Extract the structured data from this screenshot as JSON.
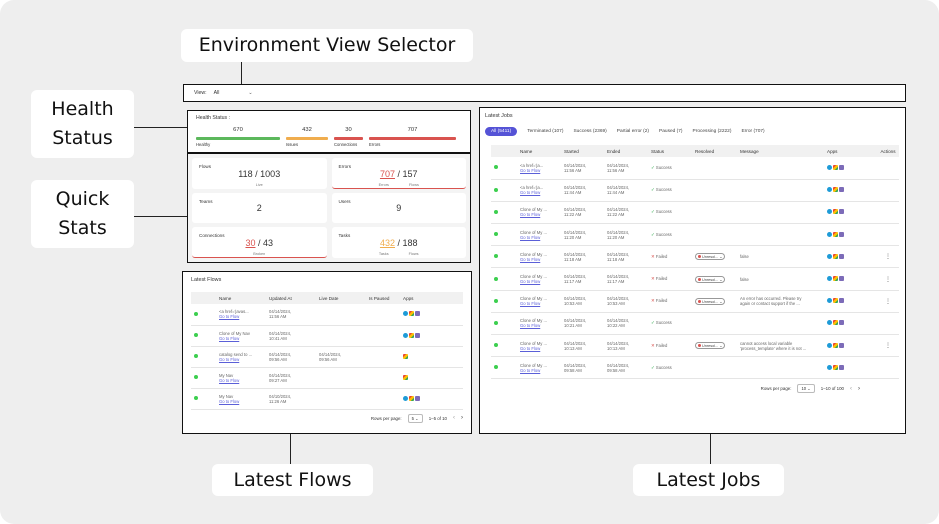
{
  "labels": {
    "env_selector": "Environment View Selector",
    "health_status": [
      "Health",
      "Status"
    ],
    "quick_stats": [
      "Quick",
      "Stats"
    ],
    "latest_flows": "Latest Flows",
    "latest_jobs": "Latest Jobs"
  },
  "view_selector": {
    "label": "View:",
    "value": "All"
  },
  "health": {
    "title": "Health Status :",
    "items": [
      {
        "value": "670",
        "label": "Healthy",
        "color": "#5cb85c"
      },
      {
        "value": "432",
        "label": "Issues",
        "color": "#f0ad4e"
      },
      {
        "value": "30",
        "label": "Connections",
        "color": "#d9534f"
      },
      {
        "value": "707",
        "label": "Errors",
        "color": "#d9534f"
      }
    ]
  },
  "quick_stats": {
    "flows": {
      "label": "Flows",
      "value": "118",
      "total": "1003",
      "sub": "Live"
    },
    "errors": {
      "label": "Errors",
      "value": "707",
      "total": "157",
      "sub1": "Errors",
      "sub2": "Flows"
    },
    "teams": {
      "label": "Teams",
      "value": "2"
    },
    "users": {
      "label": "Users",
      "value": "9"
    },
    "connections": {
      "label": "Connections",
      "value": "30",
      "total": "43",
      "sub": "Broken"
    },
    "tasks": {
      "label": "Tasks",
      "value": "432",
      "total": "188",
      "sub1": "Tasks",
      "sub2": "Flows"
    }
  },
  "flows": {
    "title": "Latest Flows",
    "columns": [
      "",
      "Name",
      "Updated At",
      "Live Date",
      "Is Paused",
      "Apps"
    ],
    "rows": [
      {
        "name": "<a href='javas...",
        "link": "Go to Flow",
        "updated": [
          "04/14/2024,",
          "11:56 AM"
        ],
        "live": [
          "",
          ""
        ]
      },
      {
        "name": "Clone of My Nav",
        "link": "Go to Flow",
        "updated": [
          "04/14/2024,",
          "10:41 AM"
        ],
        "live": [
          "",
          ""
        ]
      },
      {
        "name": "catalog send to ...",
        "link": "Go to Flow",
        "updated": [
          "04/14/2024,",
          "09:56 AM"
        ],
        "live": [
          "04/14/2024,",
          "09:56 AM"
        ]
      },
      {
        "name": "My Nav",
        "link": "Go to Flow",
        "updated": [
          "04/14/2024,",
          "09:27 AM"
        ],
        "live": [
          "",
          ""
        ]
      },
      {
        "name": "My Nav",
        "link": "Go to Flow",
        "updated": [
          "04/10/2024,",
          "11:26 AM"
        ],
        "live": [
          "",
          ""
        ]
      }
    ],
    "rows_per_page_label": "Rows per page:",
    "rows_per_page": "5",
    "range": "1–5 of 10"
  },
  "jobs": {
    "title": "Latest Jobs",
    "tabs": [
      "All (5411)",
      "Terminated (107)",
      "Success (2369)",
      "Partial error (2)",
      "Paused (7)",
      "Processing (2222)",
      "Error (707)"
    ],
    "columns": [
      "",
      "Name",
      "Started",
      "Ended",
      "Status",
      "Resolved",
      "Message",
      "Apps",
      "Actions"
    ],
    "rows": [
      {
        "name": "<a href='ja...",
        "link": "Go to Flow",
        "started": [
          "04/14/2024,",
          "11:56 AM"
        ],
        "ended": [
          "04/14/2024,",
          "11:56 AM"
        ],
        "status": "Success",
        "resolved": "",
        "message": []
      },
      {
        "name": "<a href='ja...",
        "link": "Go to Flow",
        "started": [
          "04/14/2024,",
          "11:44 AM"
        ],
        "ended": [
          "04/14/2024,",
          "11:44 AM"
        ],
        "status": "Success",
        "resolved": "",
        "message": []
      },
      {
        "name": "Clone of My ...",
        "link": "Go to Flow",
        "started": [
          "04/14/2024,",
          "11:22 AM"
        ],
        "ended": [
          "04/14/2024,",
          "11:22 AM"
        ],
        "status": "Success",
        "resolved": "",
        "message": []
      },
      {
        "name": "Clone of My ...",
        "link": "Go to Flow",
        "started": [
          "04/14/2024,",
          "11:20 AM"
        ],
        "ended": [
          "04/14/2024,",
          "11:20 AM"
        ],
        "status": "Success",
        "resolved": "",
        "message": []
      },
      {
        "name": "Clone of My ...",
        "link": "Go to Flow",
        "started": [
          "04/14/2024,",
          "11:18 AM"
        ],
        "ended": [
          "04/14/2024,",
          "11:18 AM"
        ],
        "status": "Failed",
        "resolved": "Unresol...",
        "message": [
          "false"
        ]
      },
      {
        "name": "Clone of My ...",
        "link": "Go to Flow",
        "started": [
          "04/14/2024,",
          "11:17 AM"
        ],
        "ended": [
          "04/14/2024,",
          "11:17 AM"
        ],
        "status": "Failed",
        "resolved": "Unresol...",
        "message": [
          "false"
        ]
      },
      {
        "name": "Clone of My ...",
        "link": "Go to Flow",
        "started": [
          "04/14/2024,",
          "10:53 AM"
        ],
        "ended": [
          "04/14/2024,",
          "10:53 AM"
        ],
        "status": "Failed",
        "resolved": "Unresol...",
        "message": [
          "An error has occurred. Please try",
          "again or contact support if the ..."
        ]
      },
      {
        "name": "Clone of My ...",
        "link": "Go to Flow",
        "started": [
          "04/14/2024,",
          "10:21 AM"
        ],
        "ended": [
          "04/14/2024,",
          "10:22 AM"
        ],
        "status": "Success",
        "resolved": "",
        "message": []
      },
      {
        "name": "Clone of My ...",
        "link": "Go to Flow",
        "started": [
          "04/14/2024,",
          "10:13 AM"
        ],
        "ended": [
          "04/14/2024,",
          "10:13 AM"
        ],
        "status": "Failed",
        "resolved": "Unresol...",
        "message": [
          "cannot access local variable",
          "'process_template' where it is not ..."
        ]
      },
      {
        "name": "Clone of My ...",
        "link": "Go to Flow",
        "started": [
          "04/14/2024,",
          "09:58 AM"
        ],
        "ended": [
          "04/14/2024,",
          "09:58 AM"
        ],
        "status": "Success",
        "resolved": "",
        "message": []
      }
    ],
    "rows_per_page_label": "Rows per page:",
    "rows_per_page": "10",
    "range": "1–10 of 100"
  }
}
